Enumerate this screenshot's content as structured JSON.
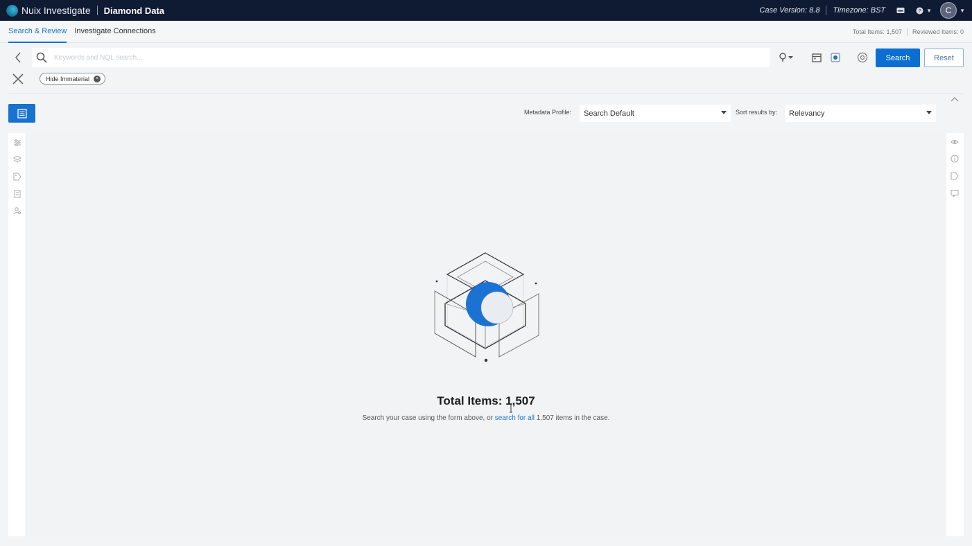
{
  "topbar": {
    "app_name": "Nuix Investigate",
    "case_name": "Diamond Data",
    "case_version": "Case Version: 8.8",
    "timezone": "Timezone: BST",
    "avatar_initial": "C"
  },
  "tabs": [
    {
      "label": "Search & Review",
      "active": true
    },
    {
      "label": "Investigate Connections",
      "active": false
    }
  ],
  "stats": {
    "total_items": "Total Items: 1,507",
    "reviewed_items": "Reviewed Items: 0"
  },
  "search": {
    "placeholder": "Keywords and NQL search...",
    "value": "",
    "search_label": "Search",
    "reset_label": "Reset"
  },
  "filters": {
    "chips": [
      {
        "label": "Hide Immaterial"
      }
    ]
  },
  "toolbar": {
    "metadata_profile_label": "Metadata Profile:",
    "metadata_profile_value": "Search Default",
    "sort_label": "Sort results by:",
    "sort_value": "Relevancy"
  },
  "empty_state": {
    "title_prefix": "Total Items:",
    "title_count": "1,507",
    "help_before": "Search your case using the form above, or ",
    "help_link": "search for all",
    "help_after": " 1,507 items in the case."
  },
  "colors": {
    "topbar_bg": "#0f1a33",
    "accent": "#0a6fd1",
    "link": "#1a73c9"
  },
  "icons": {
    "left_rail": [
      "filter-sliders-icon",
      "layers-icon",
      "tag-icon",
      "document-icon",
      "person-search-icon"
    ],
    "right_rail": [
      "eye-icon",
      "info-icon",
      "tag-outline-icon",
      "comment-icon"
    ]
  }
}
